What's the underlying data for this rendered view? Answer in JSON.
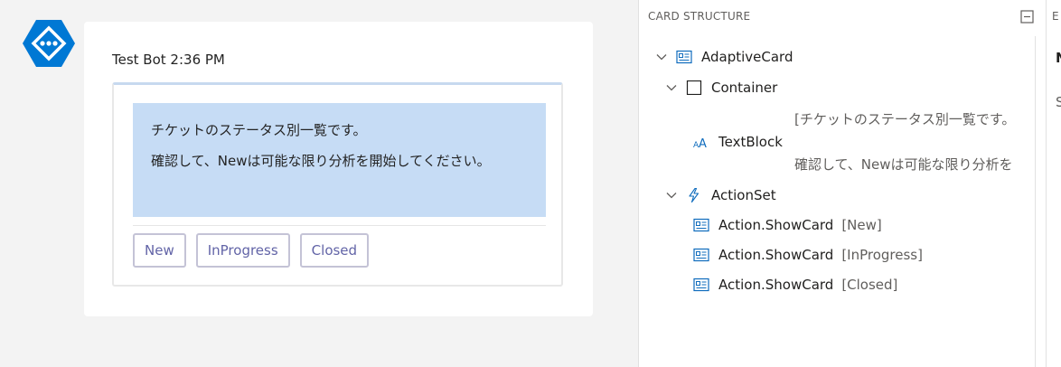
{
  "chat": {
    "bot_name": "Test Bot",
    "timestamp": "2:36 PM",
    "header": "Test Bot 2:36 PM",
    "card": {
      "line1": "チケットのステータス別一覧です。",
      "line2": "確認して、Newは可能な限り分析を開始してください。",
      "actions": [
        "New",
        "InProgress",
        "Closed"
      ]
    }
  },
  "structure": {
    "title": "CARD STRUCTURE",
    "nodes": {
      "adaptive_card": "AdaptiveCard",
      "container": "Container",
      "text_preview_1": "[チケットのステータス別一覧です。",
      "textblock": "TextBlock",
      "text_preview_2": "確認して、Newは可能な限り分析を",
      "actionset": "ActionSet",
      "action_type": "Action.ShowCard",
      "action_new": "[New]",
      "action_inprogress": "[InProgress]",
      "action_closed": "[Closed]"
    }
  },
  "side_panel": {
    "label_partial": "E",
    "bold_partial": "N",
    "text_partial": "S"
  },
  "colors": {
    "accent": "#6264a7",
    "container_bg": "#c6dcf5",
    "bot_icon": "#0078d4",
    "tree_icon": "#0f6cbd"
  },
  "icons": {
    "bot": "azure-bot-hexagon-icon",
    "collapse": "minus-square-icon",
    "adaptive_card": "card-icon",
    "container": "square-icon",
    "textblock": "text-aa-icon",
    "actionset": "lightning-icon",
    "action": "card-icon"
  }
}
